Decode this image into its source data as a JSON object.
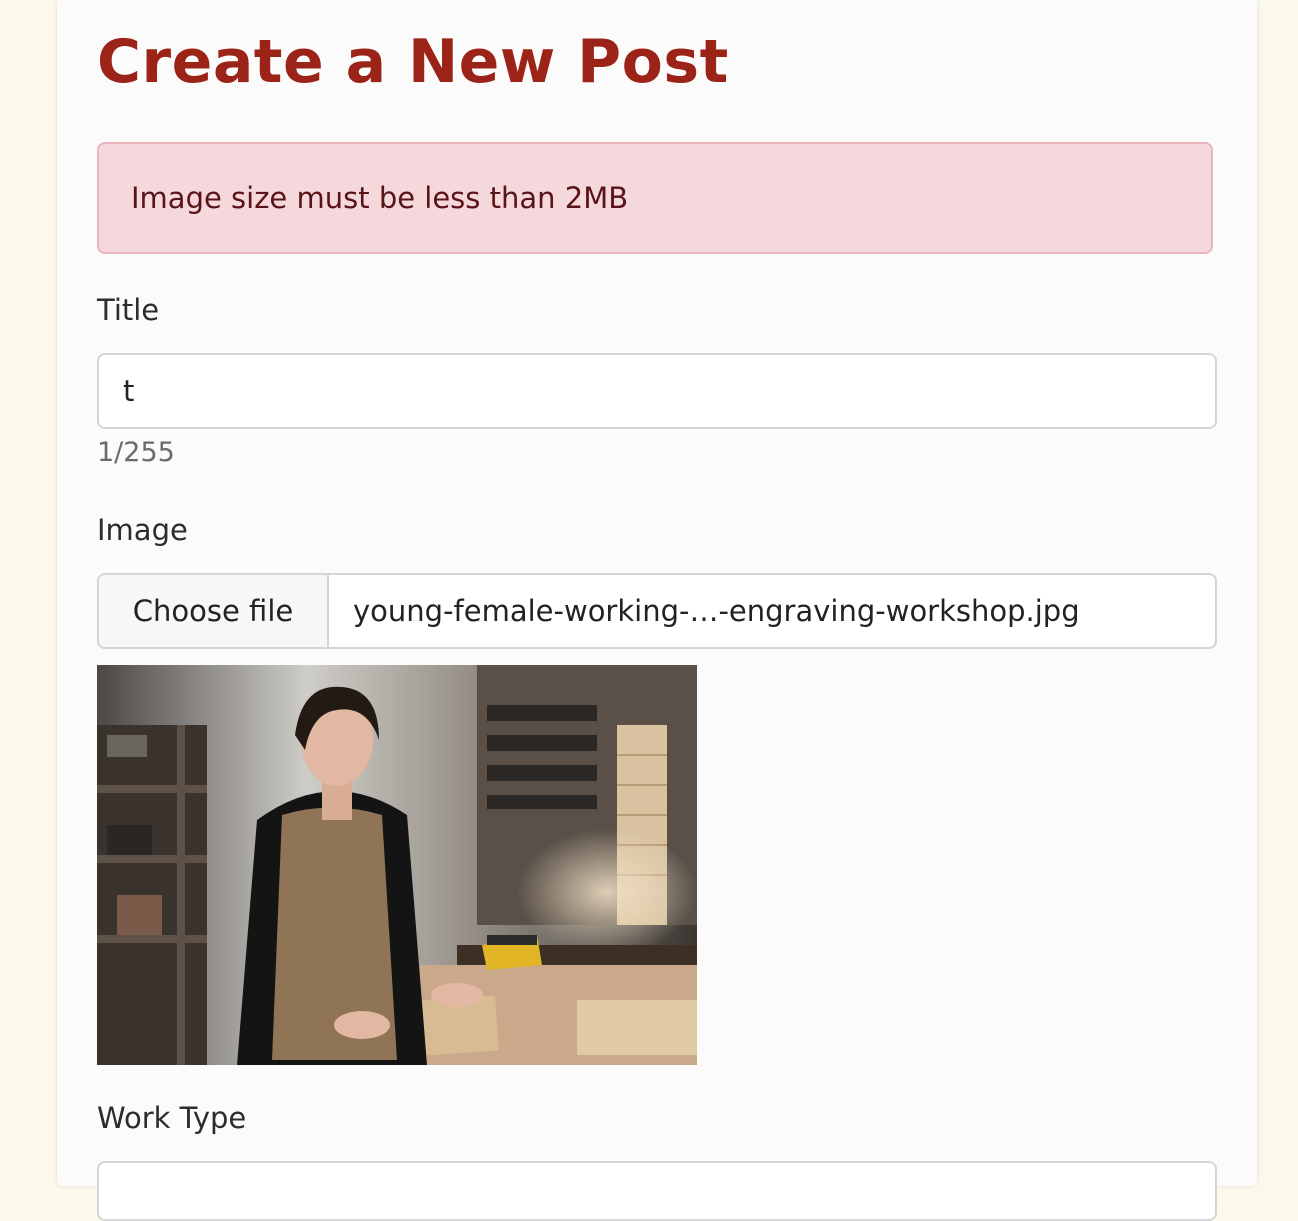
{
  "page": {
    "title": "Create a New Post"
  },
  "alert": {
    "message": "Image size must be less than 2MB"
  },
  "form": {
    "title_label": "Title",
    "title_value": "t",
    "title_counter": "1/255",
    "image_label": "Image",
    "file_button_label": "Choose file",
    "file_name": "young-female-working-…-engraving-workshop.jpg",
    "work_type_label": "Work Type"
  },
  "colors": {
    "heading": "#9b2318",
    "alert_bg": "#f4d8db",
    "alert_border": "#eab4bb",
    "page_bg": "#fcf9ec"
  },
  "icons": {
    "preview": "photo-preview"
  }
}
